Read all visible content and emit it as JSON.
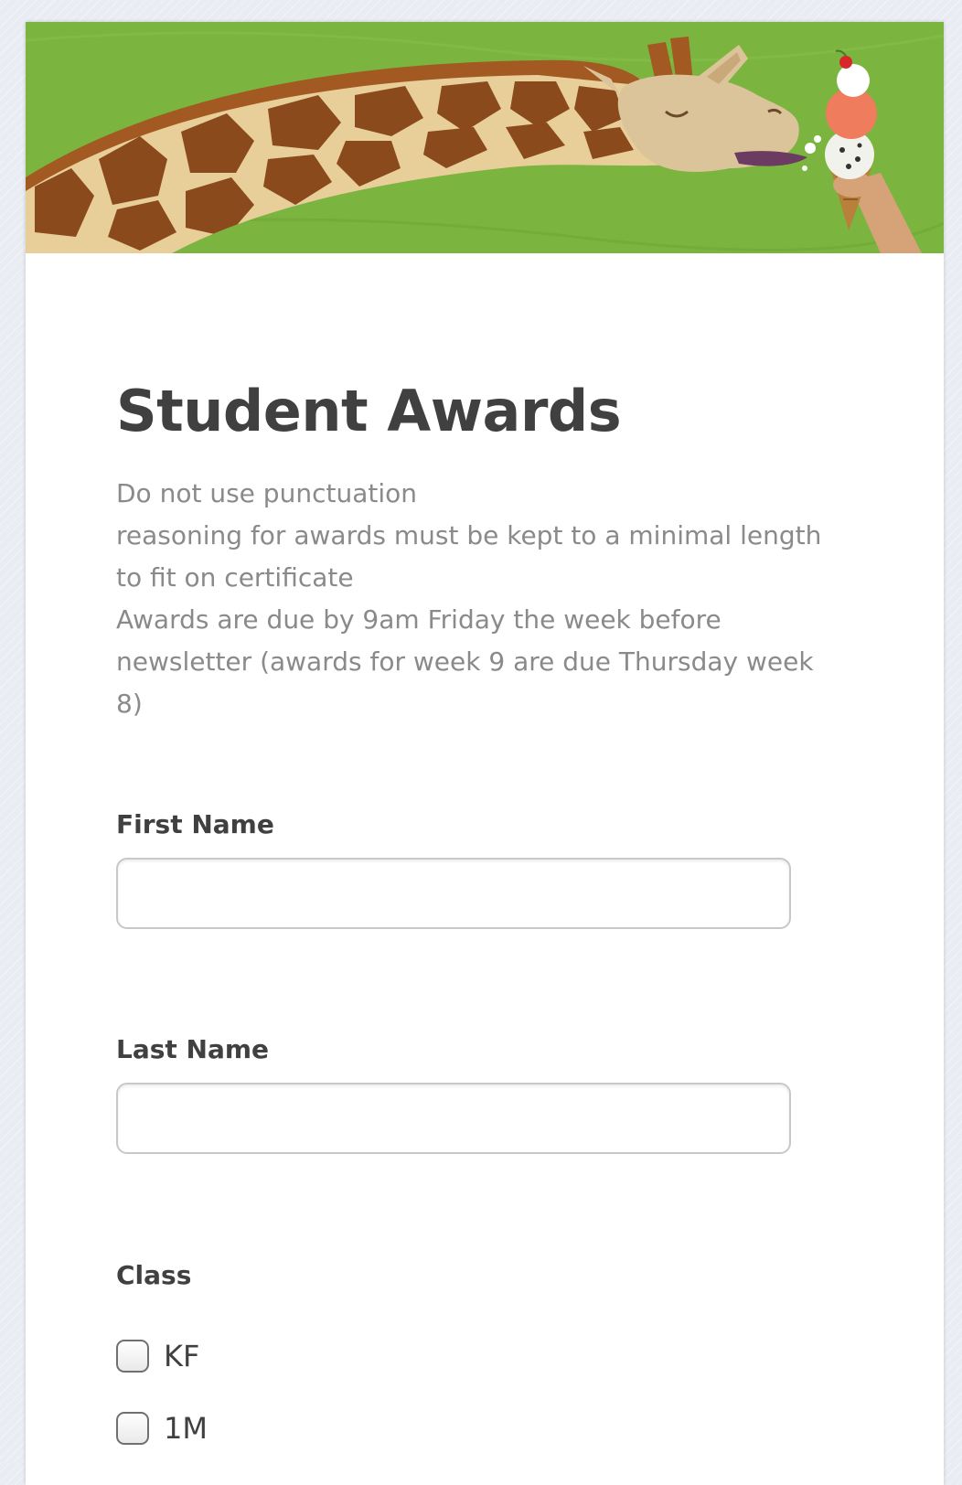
{
  "colors": {
    "banner_green": "#7bb53f",
    "giraffe_brown": "#8b4a1c",
    "giraffe_cream": "#e8cf9a",
    "title_text": "#404040",
    "description_text": "#8a8a8a",
    "input_border": "#c8c8c8"
  },
  "form": {
    "title": "Student Awards",
    "description_lines": [
      "Do not use punctuation",
      "reasoning for awards must be kept to a minimal length",
      "to fit on certificate",
      "Awards are due by 9am Friday the week before",
      "newsletter (awards for week 9 are due Thursday week",
      "8)"
    ]
  },
  "fields": {
    "first_name": {
      "label": "First Name",
      "value": "",
      "placeholder": ""
    },
    "last_name": {
      "label": "Last Name",
      "value": "",
      "placeholder": ""
    },
    "class": {
      "label": "Class",
      "options": [
        {
          "label": "KF",
          "checked": false
        },
        {
          "label": "1M",
          "checked": false
        }
      ]
    }
  },
  "icons": {
    "banner": "giraffe-eating-ice-cream-illustration",
    "checkbox": "checkbox-unchecked-icon"
  }
}
